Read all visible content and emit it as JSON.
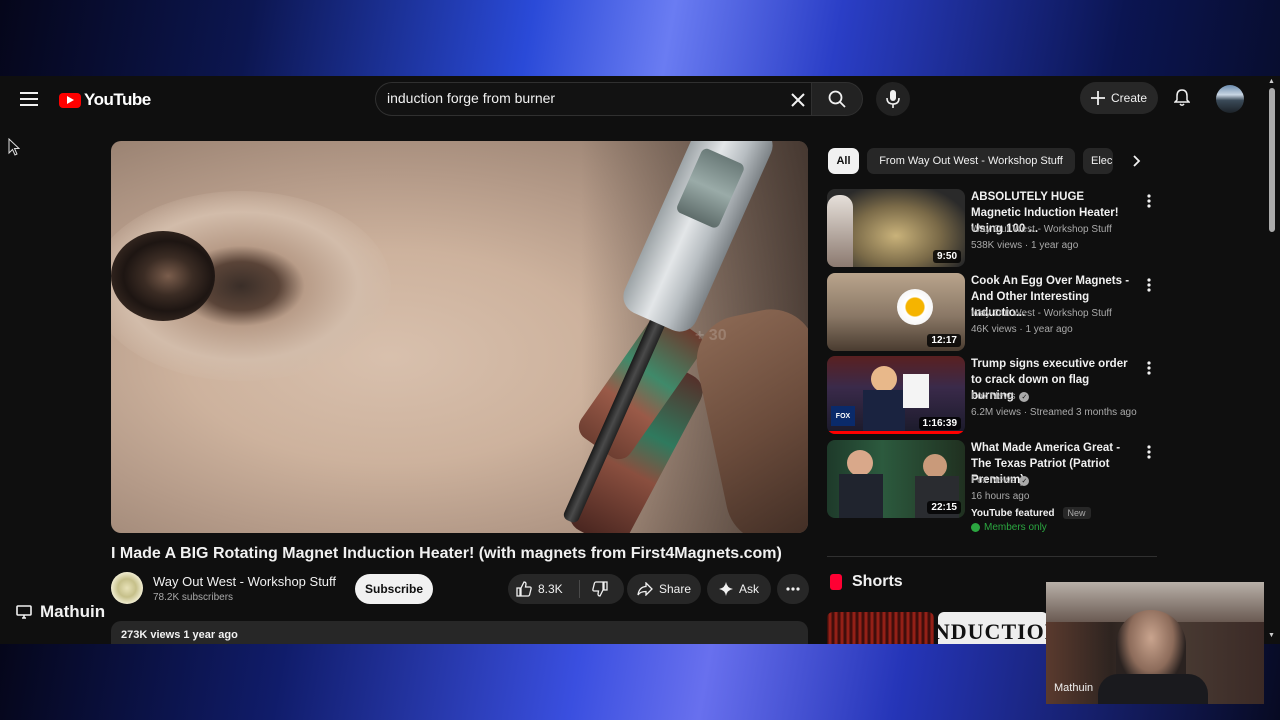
{
  "header": {
    "logo_text": "YouTube",
    "search_value": "induction forge from burner",
    "create_label": "Create"
  },
  "video": {
    "title": "I Made A BIG Rotating Magnet Induction Heater! (with magnets from First4Magnets.com)",
    "seek_hint": "+ 30",
    "channel_name": "Way Out West - Workshop Stuff",
    "channel_subs": "78.2K subscribers",
    "subscribe_label": "Subscribe",
    "likes": "8.3K",
    "share_label": "Share",
    "ask_label": "Ask",
    "views_and_date": "273K views  1 year ago"
  },
  "sidebar": {
    "chips": [
      "All",
      "From Way Out West - Workshop Stuff",
      "Elec"
    ],
    "recommendations": [
      {
        "title": "ABSOLUTELY HUGE Magnetic Induction Heater! Using 100 ...",
        "channel": "Way Out West - Workshop Stuff",
        "meta": "538K views · 1 year ago",
        "duration": "9:50",
        "verified": false
      },
      {
        "title": "Cook An Egg Over Magnets  - And Other Interesting Inductio...",
        "channel": "Way Out West - Workshop Stuff",
        "meta": "46K views · 1 year ago",
        "duration": "12:17",
        "verified": false
      },
      {
        "title": "Trump signs executive order to crack down on flag burning",
        "channel": "Fox News",
        "meta": "6.2M views · Streamed 3 months ago",
        "duration": "1:16:39",
        "verified": true
      },
      {
        "title": "What Made America Great - The Texas Patriot (Patriot Premium)",
        "channel": "Fox News",
        "meta": "16 hours ago",
        "duration": "22:15",
        "verified": true,
        "featured_label": "YouTube featured",
        "new_badge": "New",
        "members_label": "Members only"
      }
    ],
    "shorts_title": "Shorts",
    "short_2_text": "INDUCTION"
  },
  "overlay": {
    "streamer_name": "Mathuin",
    "webcam_name": "Mathuin"
  },
  "colors": {
    "youtube_red": "#ff0000",
    "members_green": "#2ba640",
    "background": "#0f0f0f"
  }
}
